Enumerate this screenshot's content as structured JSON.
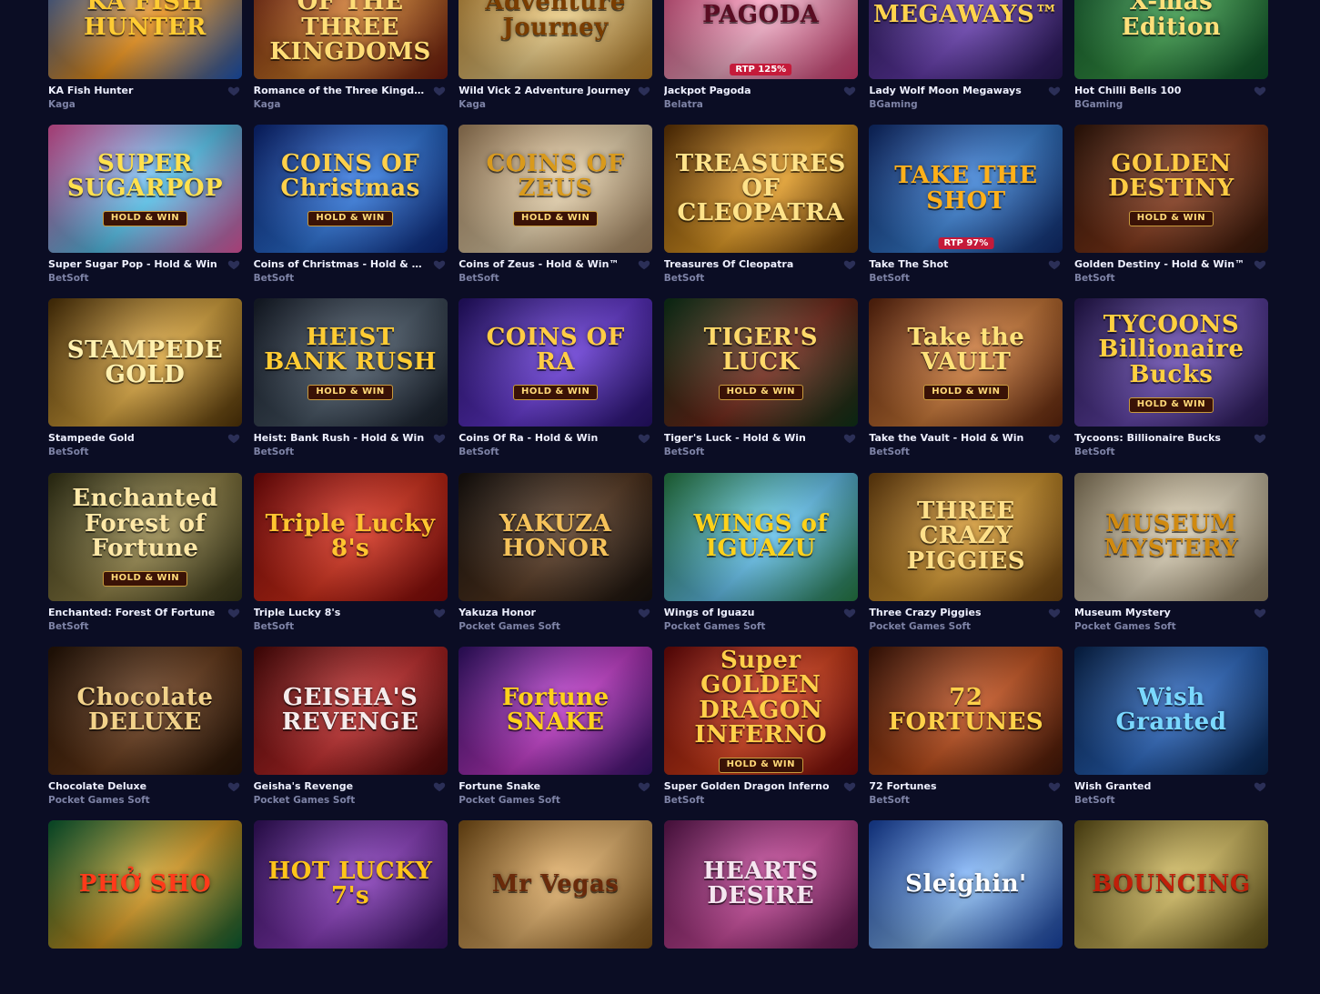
{
  "games": [
    {
      "title": "KA Fish Hunter",
      "provider": "Kaga",
      "art_text": "KA FISH HUNTER",
      "colors": [
        "#1c5fd1",
        "#ff9d1a"
      ],
      "text_color": "#ffcc33"
    },
    {
      "title": "Romance of the Three Kingdoms",
      "provider": "Kaga",
      "art_text": "ROMANCE OF THE THREE KINGDOMS",
      "colors": [
        "#7a1d10",
        "#d9812a"
      ],
      "text_color": "#ffdd77"
    },
    {
      "title": "Wild Vick 2 Adventure Journey",
      "provider": "Kaga",
      "art_text": "Adventure Journey",
      "colors": [
        "#c98a2a",
        "#f6d68a"
      ],
      "text_color": "#7a3d00"
    },
    {
      "title": "Jackpot Pagoda",
      "provider": "Belatra",
      "art_text": "PAGODA",
      "colors": [
        "#e63f7a",
        "#ffb3cf"
      ],
      "text_color": "#5a0c22",
      "rtp": "RTP 125%"
    },
    {
      "title": "Lady Wolf Moon Megaways",
      "provider": "BGaming",
      "art_text": "MEGAWAYS™",
      "colors": [
        "#2a1a5e",
        "#6b3fb8"
      ],
      "text_color": "#ffd34d"
    },
    {
      "title": "Hot Chilli Bells 100",
      "provider": "BGaming",
      "art_text": "X-mas Edition",
      "colors": [
        "#0f5c2e",
        "#3aa04a"
      ],
      "text_color": "#ffe07a"
    },
    {
      "title": "Super Sugar Pop - Hold & Win",
      "provider": "BetSoft",
      "art_text": "SUPER SUGARPOP",
      "colors": [
        "#ff5fb4",
        "#5bd2ff"
      ],
      "text_color": "#ffe14d",
      "tagline": "HOLD & WIN"
    },
    {
      "title": "Coins of Christmas - Hold & Win",
      "provider": "BetSoft",
      "art_text": "COINS OF Christmas",
      "colors": [
        "#0d2a86",
        "#2f7be8"
      ],
      "text_color": "#ffd04a",
      "tagline": "HOLD & WIN"
    },
    {
      "title": "Coins of Zeus - Hold & Win™",
      "provider": "BetSoft",
      "art_text": "COINS OF ZEUS",
      "colors": [
        "#b8946a",
        "#f2dcb4"
      ],
      "text_color": "#d99a1c",
      "tagline": "HOLD & WIN"
    },
    {
      "title": "Treasures Of Cleopatra",
      "provider": "BetSoft",
      "art_text": "TREASURES OF CLEOPATRA",
      "colors": [
        "#6b3a06",
        "#f2a626"
      ],
      "text_color": "#ffe38a"
    },
    {
      "title": "Take The Shot",
      "provider": "BetSoft",
      "art_text": "TAKE THE SHOT",
      "colors": [
        "#12307a",
        "#3a86e0"
      ],
      "text_color": "#ffb01a",
      "rtp": "RTP 97%"
    },
    {
      "title": "Golden Destiny - Hold & Win™",
      "provider": "BetSoft",
      "art_text": "GOLDEN DESTINY",
      "colors": [
        "#3a1a0c",
        "#8a3a1a"
      ],
      "text_color": "#ffcc44",
      "tagline": "HOLD & WIN"
    },
    {
      "title": "Stampede Gold",
      "provider": "BetSoft",
      "art_text": "STAMPEDE GOLD",
      "colors": [
        "#5a3a0a",
        "#e8b040"
      ],
      "text_color": "#fff1b0"
    },
    {
      "title": "Heist: Bank Rush - Hold & Win",
      "provider": "BetSoft",
      "art_text": "HEIST BANK RUSH",
      "colors": [
        "#1a2230",
        "#4a5a6a"
      ],
      "text_color": "#ffcc33",
      "tagline": "HOLD & WIN"
    },
    {
      "title": "Coins Of Ra - Hold & Win",
      "provider": "BetSoft",
      "art_text": "COINS OF RA",
      "colors": [
        "#2a1478",
        "#6a3ae0"
      ],
      "text_color": "#ffcc44",
      "tagline": "HOLD & WIN"
    },
    {
      "title": "Tiger's Luck - Hold & Win",
      "provider": "BetSoft",
      "art_text": "TIGER'S LUCK",
      "colors": [
        "#0f3a1c",
        "#7a2a1a"
      ],
      "text_color": "#ffd96a",
      "tagline": "HOLD & WIN"
    },
    {
      "title": "Take the Vault - Hold & Win",
      "provider": "BetSoft",
      "art_text": "Take the VAULT",
      "colors": [
        "#6a2a10",
        "#d9803a"
      ],
      "text_color": "#ffe27a",
      "tagline": "HOLD & WIN"
    },
    {
      "title": "Tycoons: Billionaire Bucks",
      "provider": "BetSoft",
      "art_text": "TYCOONS Billionaire Bucks",
      "colors": [
        "#2a1a5a",
        "#6a4ab8"
      ],
      "text_color": "#ffd040",
      "tagline": "HOLD & WIN"
    },
    {
      "title": "Enchanted: Forest Of Fortune",
      "provider": "BetSoft",
      "art_text": "Enchanted Forest of Fortune",
      "colors": [
        "#3a3a1a",
        "#9a8a4a"
      ],
      "text_color": "#ffe9a8",
      "tagline": "HOLD & WIN"
    },
    {
      "title": "Triple Lucky 8's",
      "provider": "BetSoft",
      "art_text": "Triple Lucky 8's",
      "colors": [
        "#8a0a0a",
        "#e0301a"
      ],
      "text_color": "#ffc430"
    },
    {
      "title": "Yakuza Honor",
      "provider": "Pocket Games Soft",
      "art_text": "YAKUZA HONOR",
      "colors": [
        "#1a1410",
        "#5a3a22"
      ],
      "text_color": "#f5c25a"
    },
    {
      "title": "Wings of Iguazu",
      "provider": "Pocket Games Soft",
      "art_text": "WINGS of IGUAZU",
      "colors": [
        "#2a8a4a",
        "#6ad0ff"
      ],
      "text_color": "#ffd21a"
    },
    {
      "title": "Three Crazy Piggies",
      "provider": "Pocket Games Soft",
      "art_text": "THREE CRAZY PIGGIES",
      "colors": [
        "#7a4a12",
        "#e0a030"
      ],
      "text_color": "#ffe08a"
    },
    {
      "title": "Museum Mystery",
      "provider": "Pocket Games Soft",
      "art_text": "MUSEUM MYSTERY",
      "colors": [
        "#9a8a6a",
        "#e8dcc0"
      ],
      "text_color": "#d08a10"
    },
    {
      "title": "Chocolate Deluxe",
      "provider": "Pocket Games Soft",
      "art_text": "Chocolate DELUXE",
      "colors": [
        "#2a1608",
        "#6a3a18"
      ],
      "text_color": "#f2d28a"
    },
    {
      "title": "Geisha's Revenge",
      "provider": "Pocket Games Soft",
      "art_text": "GEISHA'S REVENGE",
      "colors": [
        "#5a0a0a",
        "#c82a2a"
      ],
      "text_color": "#f5ecec"
    },
    {
      "title": "Fortune Snake",
      "provider": "Pocket Games Soft",
      "art_text": "Fortune SNAKE",
      "colors": [
        "#3a1478",
        "#c83ad0"
      ],
      "text_color": "#ffd21a"
    },
    {
      "title": "Super Golden Dragon Inferno",
      "provider": "BetSoft",
      "art_text": "Super GOLDEN DRAGON INFERNO",
      "colors": [
        "#7a0a0a",
        "#e0401a"
      ],
      "text_color": "#ffd04a",
      "tagline": "HOLD & WIN"
    },
    {
      "title": "72 Fortunes",
      "provider": "BetSoft",
      "art_text": "72 FORTUNES",
      "colors": [
        "#4a1a0a",
        "#c8501a"
      ],
      "text_color": "#ffd24a"
    },
    {
      "title": "Wish Granted",
      "provider": "BetSoft",
      "art_text": "Wish Granted",
      "colors": [
        "#0a2a5a",
        "#2a6ac8"
      ],
      "text_color": "#7ad8ff"
    },
    {
      "title": "",
      "provider": "",
      "art_text": "PHỞ SHO",
      "colors": [
        "#0a6a3a",
        "#e0a020"
      ],
      "text_color": "#ff3a1a"
    },
    {
      "title": "",
      "provider": "",
      "art_text": "HOT LUCKY 7's",
      "colors": [
        "#3a146a",
        "#8a3ac0"
      ],
      "text_color": "#ffc41a"
    },
    {
      "title": "",
      "provider": "",
      "art_text": "Mr Vegas",
      "colors": [
        "#8a5a1a",
        "#e8b46a"
      ],
      "text_color": "#6a2a0a"
    },
    {
      "title": "",
      "provider": "",
      "art_text": "HEARTS DESIRE",
      "colors": [
        "#6a1a5a",
        "#d04aa0"
      ],
      "text_color": "#f5e6f0"
    },
    {
      "title": "",
      "provider": "",
      "art_text": "Sleighin'",
      "colors": [
        "#1a4ab8",
        "#8ac0ff"
      ],
      "text_color": "#ffffff"
    },
    {
      "title": "",
      "provider": "",
      "art_text": "BOUNCING",
      "colors": [
        "#6a5a1a",
        "#d8c060"
      ],
      "text_color": "#c0200a"
    }
  ]
}
